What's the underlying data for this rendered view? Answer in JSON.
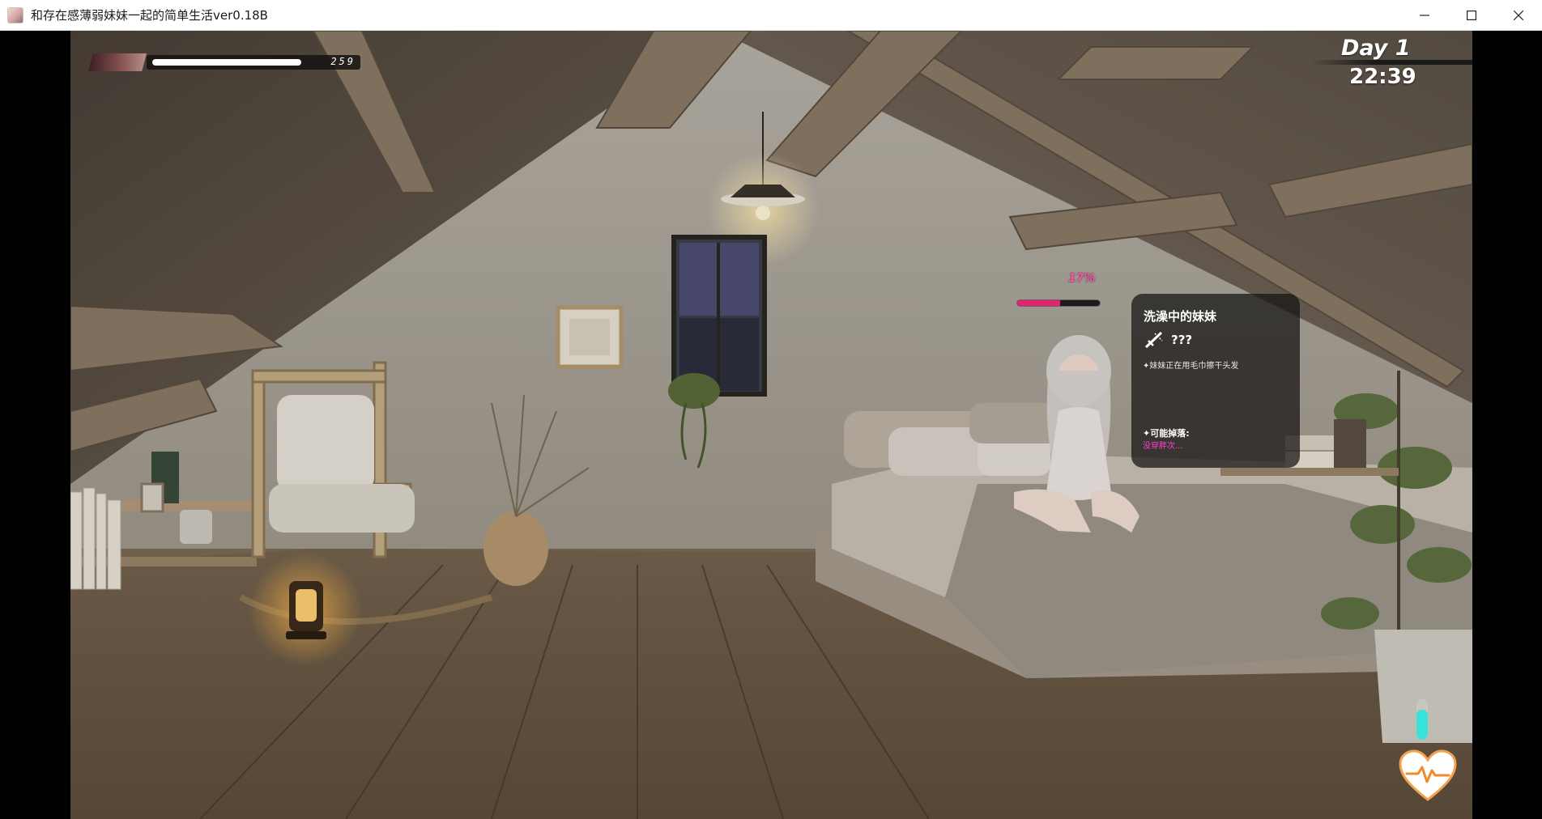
{
  "window": {
    "title": "和存在感薄弱妹妹一起的简单生活ver0.18B",
    "controls": [
      "minimize",
      "maximize",
      "close"
    ]
  },
  "hud": {
    "energy": {
      "value": "259",
      "fill_fraction": 0.97
    },
    "day_label": "Day 1",
    "time": "22:39"
  },
  "character": {
    "progress_text": "17%",
    "progress_fraction": 0.52
  },
  "info_panel": {
    "title": "洗澡中的妹妹",
    "skill_icon": "sword-icon",
    "skill_text": "???",
    "description": "✦妹妹正在用毛巾擦干头发",
    "drop_label": "✦可能掉落:",
    "drop_value": "没穿胖次..."
  },
  "widgets": {
    "gauge_fraction": 0.75,
    "gauge_color": "#38e3da",
    "heart_icon": "heart-pulse-icon",
    "heart_color": "#ffffff"
  },
  "colors": {
    "pink_accent": "#e2246e",
    "magenta_text": "#ff3fd2",
    "panel_bg": "#141211"
  }
}
